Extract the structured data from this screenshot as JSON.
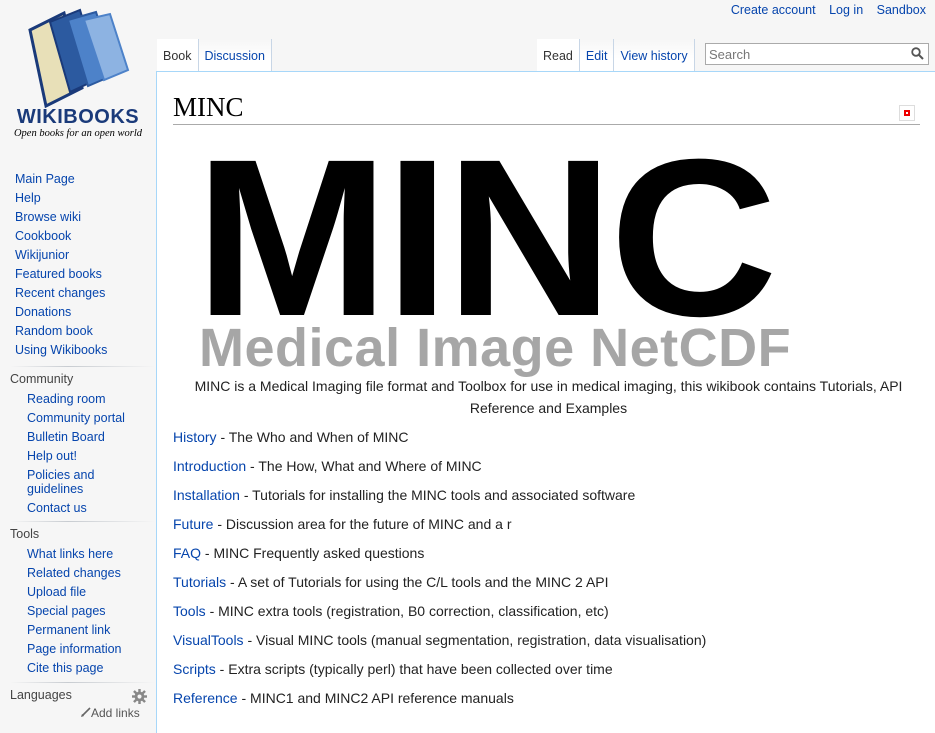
{
  "logo": {
    "wordmark": "WIKIBOOKS",
    "tagline": "Open books for an open world"
  },
  "personal_tools": [
    "Create account",
    "Log in",
    "Sandbox"
  ],
  "tabs": {
    "book": "Book",
    "discussion": "Discussion",
    "read": "Read",
    "edit": "Edit",
    "history": "View history"
  },
  "search": {
    "placeholder": "Search"
  },
  "navigation": [
    "Main Page",
    "Help",
    "Browse wiki",
    "Cookbook",
    "Wikijunior",
    "Featured books",
    "Recent changes",
    "Donations",
    "Random book",
    "Using Wikibooks"
  ],
  "community": {
    "heading": "Community",
    "items": [
      "Reading room",
      "Community portal",
      "Bulletin Board",
      "Help out!",
      "Policies and guidelines",
      "Contact us"
    ]
  },
  "tools": {
    "heading": "Tools",
    "items": [
      "What links here",
      "Related changes",
      "Upload file",
      "Special pages",
      "Permanent link",
      "Page information",
      "Cite this page"
    ]
  },
  "languages": {
    "heading": "Languages",
    "add_links": "Add links"
  },
  "page": {
    "title": "MINC",
    "banner_big": "MINC",
    "banner_sub": "Medical Image NetCDF",
    "description": "MINC is a Medical Imaging file format and Toolbox for use in medical imaging, this wikibook contains Tutorials, API Reference and Examples",
    "links": [
      {
        "link": "History",
        "text": " - The Who and When of MINC"
      },
      {
        "link": "Introduction",
        "text": " - The How, What and Where of MINC"
      },
      {
        "link": "Installation",
        "text": " - Tutorials for installing the MINC tools and associated software"
      },
      {
        "link": "Future",
        "text": " - Discussion area for the future of MINC and a r"
      },
      {
        "link": "FAQ",
        "text": " - MINC Frequently asked questions"
      },
      {
        "link": "Tutorials",
        "text": " - A set of Tutorials for using the C/L tools and the MINC 2 API"
      },
      {
        "link": "Tools",
        "text": " - MINC extra tools (registration, B0 correction, classification, etc)"
      },
      {
        "link": "VisualTools",
        "text": " - Visual MINC tools (manual segmentation, registration, data visualisation)"
      },
      {
        "link": "Scripts",
        "text": " - Extra scripts (typically perl) that have been collected over time"
      },
      {
        "link": "Reference",
        "text": " - MINC1 and MINC2 API reference manuals"
      }
    ]
  },
  "colors": {
    "link": "#0645ad",
    "banner_sub": "#a6a6a6",
    "border": "#a7d7f9"
  },
  "icons": [
    "search-icon",
    "gear-icon",
    "pencil-icon",
    "book-logo-icon"
  ]
}
